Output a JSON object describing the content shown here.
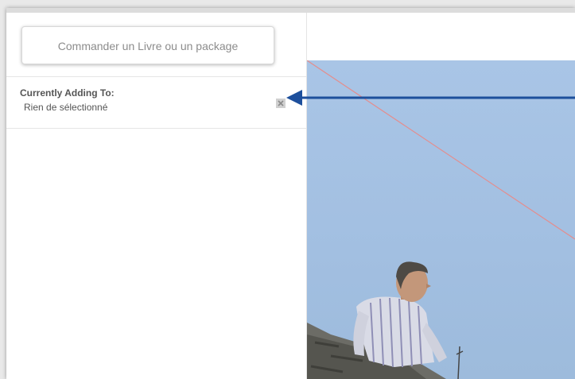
{
  "sidebar": {
    "order_button_label": "Commander un Livre ou un package",
    "adding_to": {
      "title": "Currently Adding To:",
      "value": "Rien de sélectionné"
    }
  },
  "icons": {
    "close": "close-icon",
    "annotation_arrow": "arrow-left-icon"
  },
  "colors": {
    "arrow": "#1d4f9c",
    "guide_line": "#e48d8d",
    "sky": "#a7c3e4"
  }
}
